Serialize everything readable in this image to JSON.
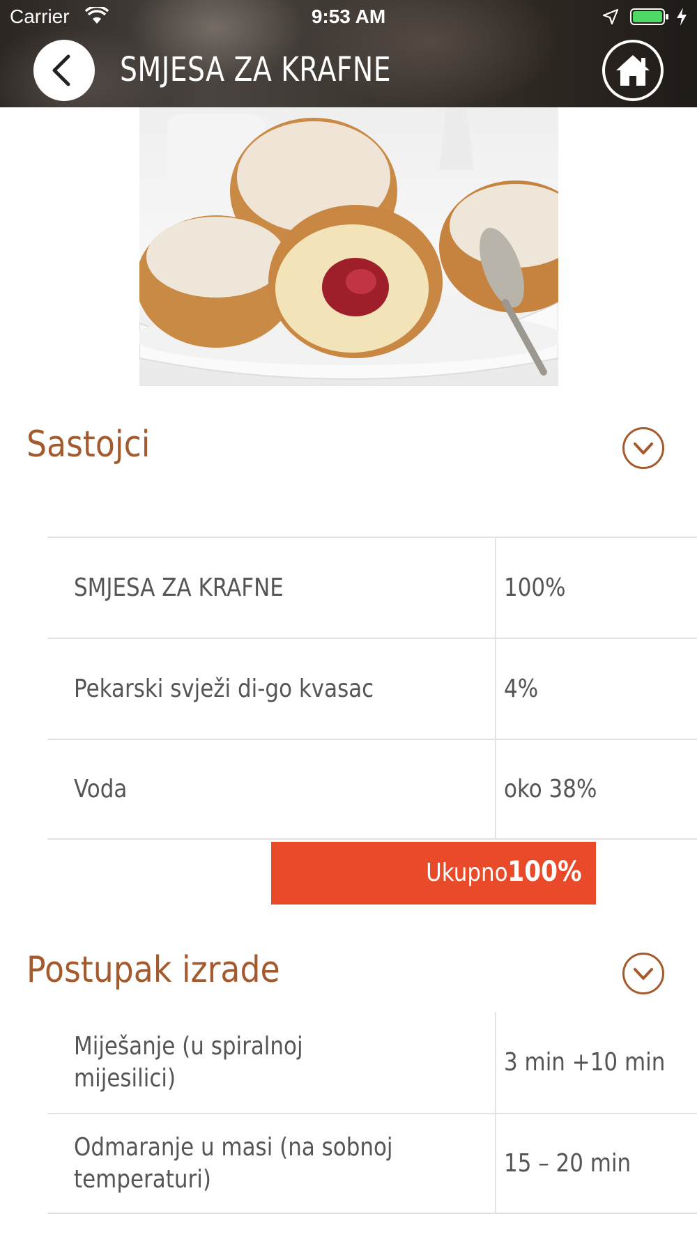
{
  "status_bar": {
    "carrier": "Carrier",
    "time": "9:53 AM"
  },
  "header": {
    "title": "SMJESA ZA KRAFNE",
    "back_icon": "chevron-left-icon",
    "home_icon": "home-icon"
  },
  "hero_image": {
    "subject": "krafne"
  },
  "ingredients": {
    "title": "Sastojci",
    "rows": [
      {
        "name": "SMJESA ZA KRAFNE",
        "value": "100%"
      },
      {
        "name": "Pekarski svježi di-go kvasac",
        "value": "4%"
      },
      {
        "name": "Voda",
        "value": "oko 38%"
      }
    ],
    "total_label": "Ukupno",
    "total_value": "100%"
  },
  "procedure": {
    "title": "Postupak izrade",
    "rows": [
      {
        "name": "Miješanje (u spiralnoj mijesilici)",
        "value": "3 min +10 min"
      },
      {
        "name": "Odmaranje u masi (na sobnoj temperaturi)",
        "value": "15 – 20 min"
      }
    ]
  },
  "colors": {
    "accent": "#a45a2c",
    "total_bar": "#e94a29",
    "battery": "#4cd964"
  }
}
